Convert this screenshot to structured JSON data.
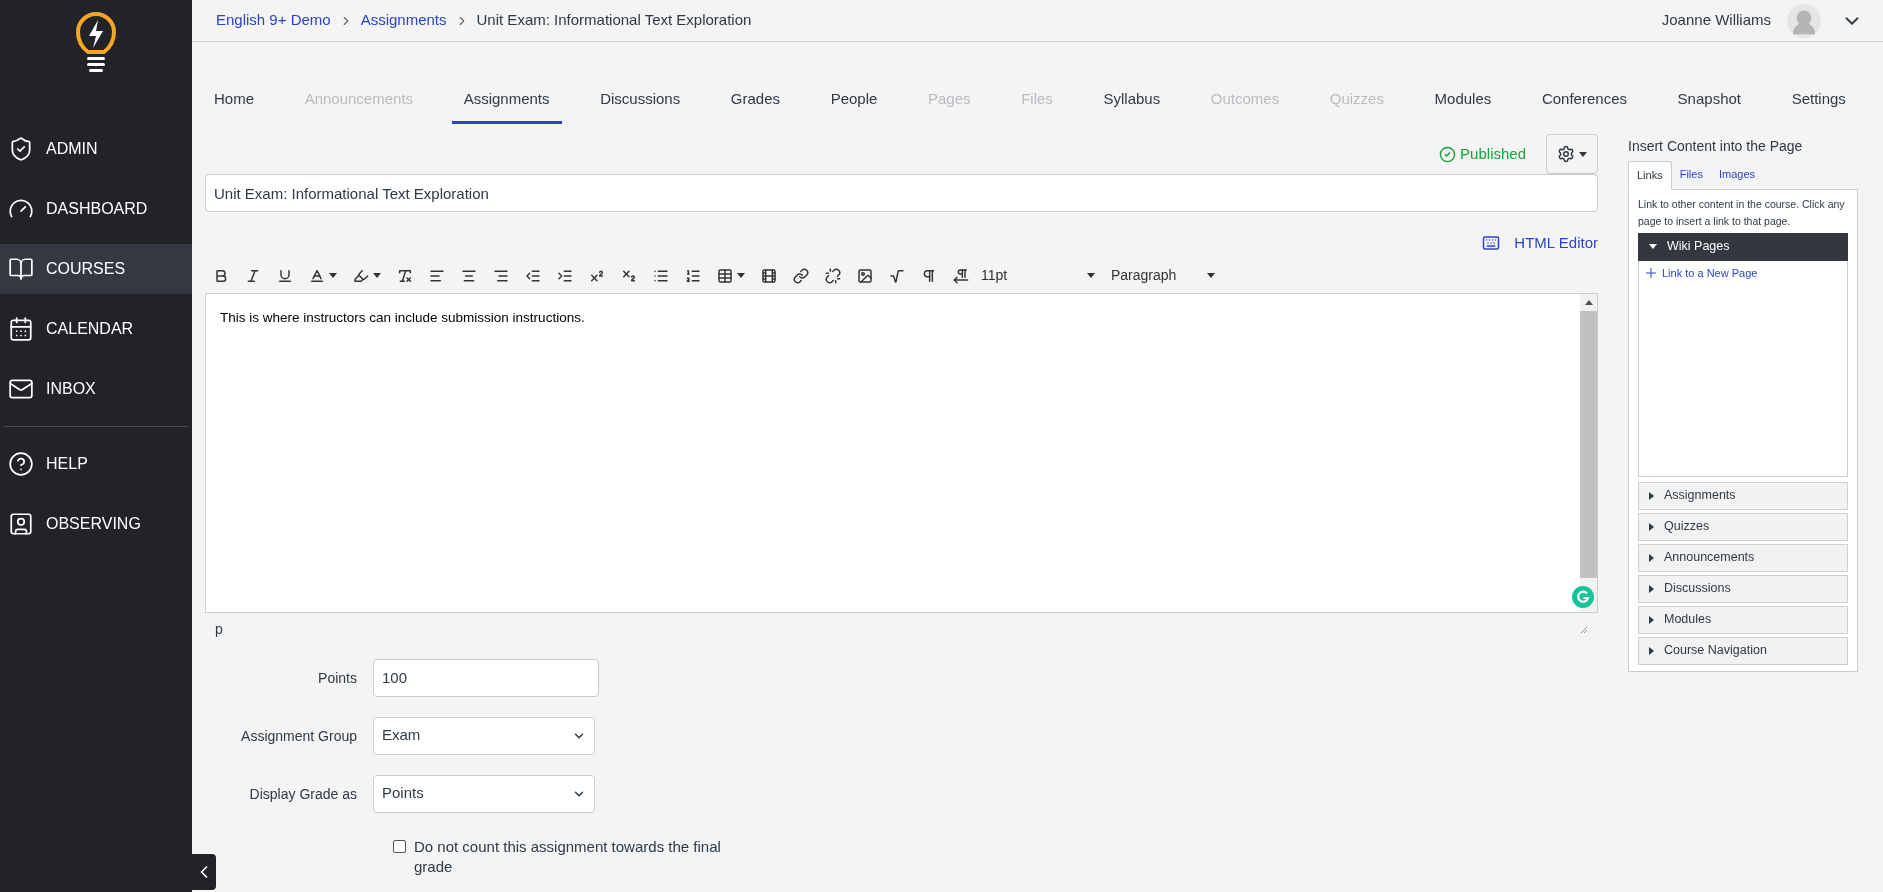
{
  "sidebar": {
    "items": [
      {
        "label": "ADMIN",
        "selected": false
      },
      {
        "label": "DASHBOARD",
        "selected": false
      },
      {
        "label": "COURSES",
        "selected": true
      },
      {
        "label": "CALENDAR",
        "selected": false
      },
      {
        "label": "INBOX",
        "selected": false
      }
    ],
    "secondary_items": [
      {
        "label": "HELP",
        "selected": false
      },
      {
        "label": "OBSERVING",
        "selected": false
      }
    ]
  },
  "breadcrumbs": [
    "English 9+ Demo",
    "Assignments",
    "Unit Exam: Informational Text Exploration"
  ],
  "user": {
    "name": "Joanne Williams"
  },
  "tabs": [
    {
      "label": "Home",
      "selected": false,
      "disabled": false
    },
    {
      "label": "Announcements",
      "selected": false,
      "disabled": true
    },
    {
      "label": "Assignments",
      "selected": true,
      "disabled": false
    },
    {
      "label": "Discussions",
      "selected": false,
      "disabled": false
    },
    {
      "label": "Grades",
      "selected": false,
      "disabled": false
    },
    {
      "label": "People",
      "selected": false,
      "disabled": false
    },
    {
      "label": "Pages",
      "selected": false,
      "disabled": true
    },
    {
      "label": "Files",
      "selected": false,
      "disabled": true
    },
    {
      "label": "Syllabus",
      "selected": false,
      "disabled": false
    },
    {
      "label": "Outcomes",
      "selected": false,
      "disabled": true
    },
    {
      "label": "Quizzes",
      "selected": false,
      "disabled": true
    },
    {
      "label": "Modules",
      "selected": false,
      "disabled": false
    },
    {
      "label": "Conferences",
      "selected": false,
      "disabled": false
    },
    {
      "label": "Snapshot",
      "selected": false,
      "disabled": false
    },
    {
      "label": "Settings",
      "selected": false,
      "disabled": false
    }
  ],
  "status": {
    "label": "Published",
    "published": true
  },
  "title_field": {
    "value": "Unit Exam: Informational Text Exploration"
  },
  "html_editor_link": "HTML Editor",
  "editor": {
    "font_size": "11pt",
    "block_format": "Paragraph",
    "content": "This is where instructors can include submission instructions.",
    "path": "p"
  },
  "form": {
    "points": {
      "label": "Points",
      "value": "100"
    },
    "assignment_group": {
      "label": "Assignment Group",
      "value": "Exam"
    },
    "display_grade": {
      "label": "Display Grade as",
      "value": "Points"
    },
    "omit_from_final": {
      "label": "Do not count this assignment towards the final grade",
      "checked": false
    }
  },
  "insert_panel": {
    "title": "Insert Content into the Page",
    "tabs": [
      {
        "label": "Links",
        "selected": true
      },
      {
        "label": "Files",
        "selected": false
      },
      {
        "label": "Images",
        "selected": false
      }
    ],
    "description": "Link to other content in the course. Click any page to insert a link to that page.",
    "sections": [
      {
        "label": "Wiki Pages",
        "expanded": true,
        "children": [
          {
            "label": "Link to a New Page"
          }
        ]
      },
      {
        "label": "Assignments",
        "expanded": false
      },
      {
        "label": "Quizzes",
        "expanded": false
      },
      {
        "label": "Announcements",
        "expanded": false
      },
      {
        "label": "Discussions",
        "expanded": false
      },
      {
        "label": "Modules",
        "expanded": false
      },
      {
        "label": "Course Navigation",
        "expanded": false
      }
    ]
  }
}
